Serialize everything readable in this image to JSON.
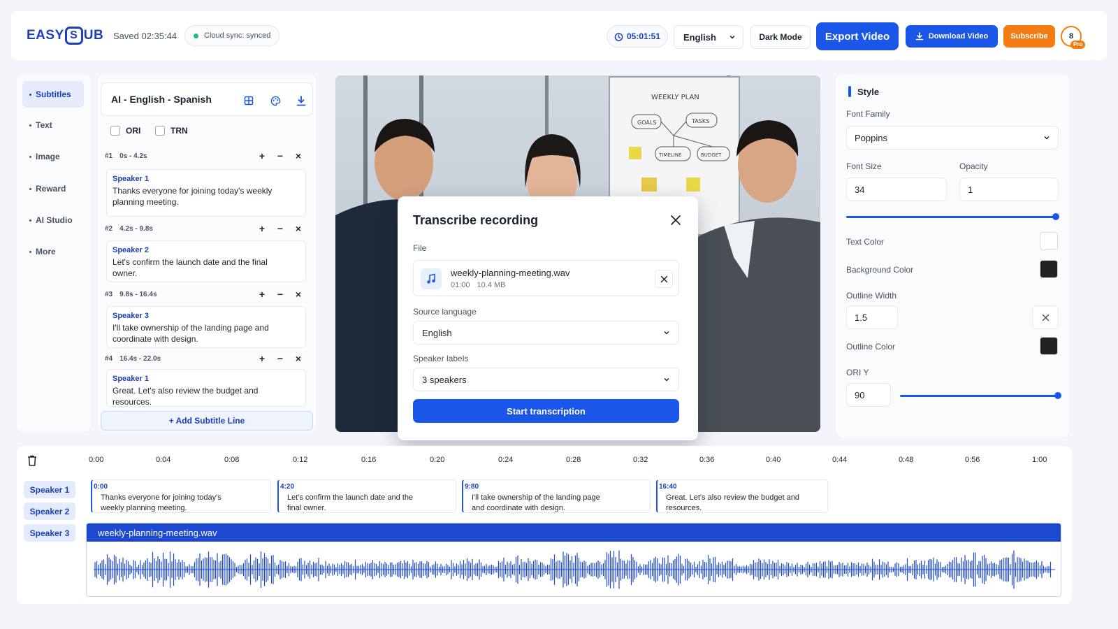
{
  "header": {
    "logo_left": "EASY",
    "logo_badge": "S",
    "logo_right": "UB",
    "saved": "Saved 02:35:44",
    "sync": "Cloud sync: synced",
    "timer": "05:01:51",
    "language": "English",
    "dark_mode": "Dark Mode",
    "export": "Export Video",
    "download": "Download Video",
    "subscribe": "Subscribe",
    "avatar": "8",
    "badge": "Pro"
  },
  "nav": {
    "items": [
      {
        "label": "Subtitles",
        "active": true
      },
      {
        "label": "Text"
      },
      {
        "label": "Image"
      },
      {
        "label": "Reward"
      },
      {
        "label": "AI Studio"
      },
      {
        "label": "More"
      }
    ]
  },
  "subtitles": {
    "title": "AI - English - Spanish",
    "check_ori": "ORI",
    "check_trn": "TRN",
    "cues": [
      {
        "index": "#1",
        "range": "0s - 4.2s",
        "speaker": "Speaker 1",
        "text": "Thanks everyone for joining today's weekly planning meeting."
      },
      {
        "index": "#2",
        "range": "4.2s - 9.8s",
        "speaker": "Speaker 2",
        "text": "Let's confirm the launch date and the final owner."
      },
      {
        "index": "#3",
        "range": "9.8s - 16.4s",
        "speaker": "Speaker 3",
        "text": "I'll take ownership of the landing page and coordinate with design."
      },
      {
        "index": "#4",
        "range": "16.4s - 22.0s",
        "speaker": "Speaker 1",
        "text": "Great. Let's also review the budget and resources."
      }
    ],
    "ctrl_add": "+",
    "ctrl_remove": "−",
    "ctrl_delete": "×",
    "add_line": "+ Add Subtitle Line"
  },
  "video": {
    "board_title": "WEEKLY PLAN",
    "board_items": [
      "GOALS",
      "TASKS",
      "TIMELINE",
      "BUDGET"
    ]
  },
  "modal": {
    "title": "Transcribe recording",
    "file_label": "File",
    "file_name": "weekly-planning-meeting.wav",
    "file_duration": "01:00",
    "file_size": "10.4 MB",
    "source_label": "Source language",
    "source_value": "English",
    "speakers_label": "Speaker labels",
    "speakers_value": "3 speakers",
    "start": "Start transcription"
  },
  "style": {
    "title": "Style",
    "font_family_label": "Font Family",
    "font_family": "Poppins",
    "font_size_label": "Font Size",
    "font_size": "34",
    "opacity_label": "Opacity",
    "opacity": "1",
    "opacity_slider": 1.0,
    "text_color_label": "Text Color",
    "text_color": "#ffffff",
    "bg_color_label": "Background Color",
    "bg_color": "#222222",
    "outline_width_label": "Outline Width",
    "outline_width": "1.5",
    "outline_color_label": "Outline Color",
    "outline_color": "#222222",
    "ori_y_label": "ORI Y",
    "ori_y": "90",
    "ori_y_slider": 1.0
  },
  "timeline": {
    "ticks": [
      "0:00",
      "0:04",
      "0:08",
      "0:12",
      "0:16",
      "0:20",
      "0:24",
      "0:28",
      "0:32",
      "0:36",
      "0:40",
      "0:44",
      "0:48",
      "0:56",
      "1:00"
    ],
    "speakers": [
      "Speaker 1",
      "Speaker 2",
      "Speaker 3"
    ],
    "cues": [
      {
        "time": "0:00",
        "text": "Thanks everyone for joining today's weekly planning meeting."
      },
      {
        "time": "4:20",
        "text": "Let's confirm the launch date and the final owner."
      },
      {
        "time": "9:80",
        "text": "I'll take ownership of the landing page and coordinate with design."
      },
      {
        "time": "16:40",
        "text": "Great. Let's also review the budget and resources."
      }
    ],
    "track_name": "weekly-planning-meeting.wav"
  },
  "colors": {
    "accent": "#1a56e8",
    "orange": "#f57c12",
    "sync_ok": "#1fbf75"
  }
}
